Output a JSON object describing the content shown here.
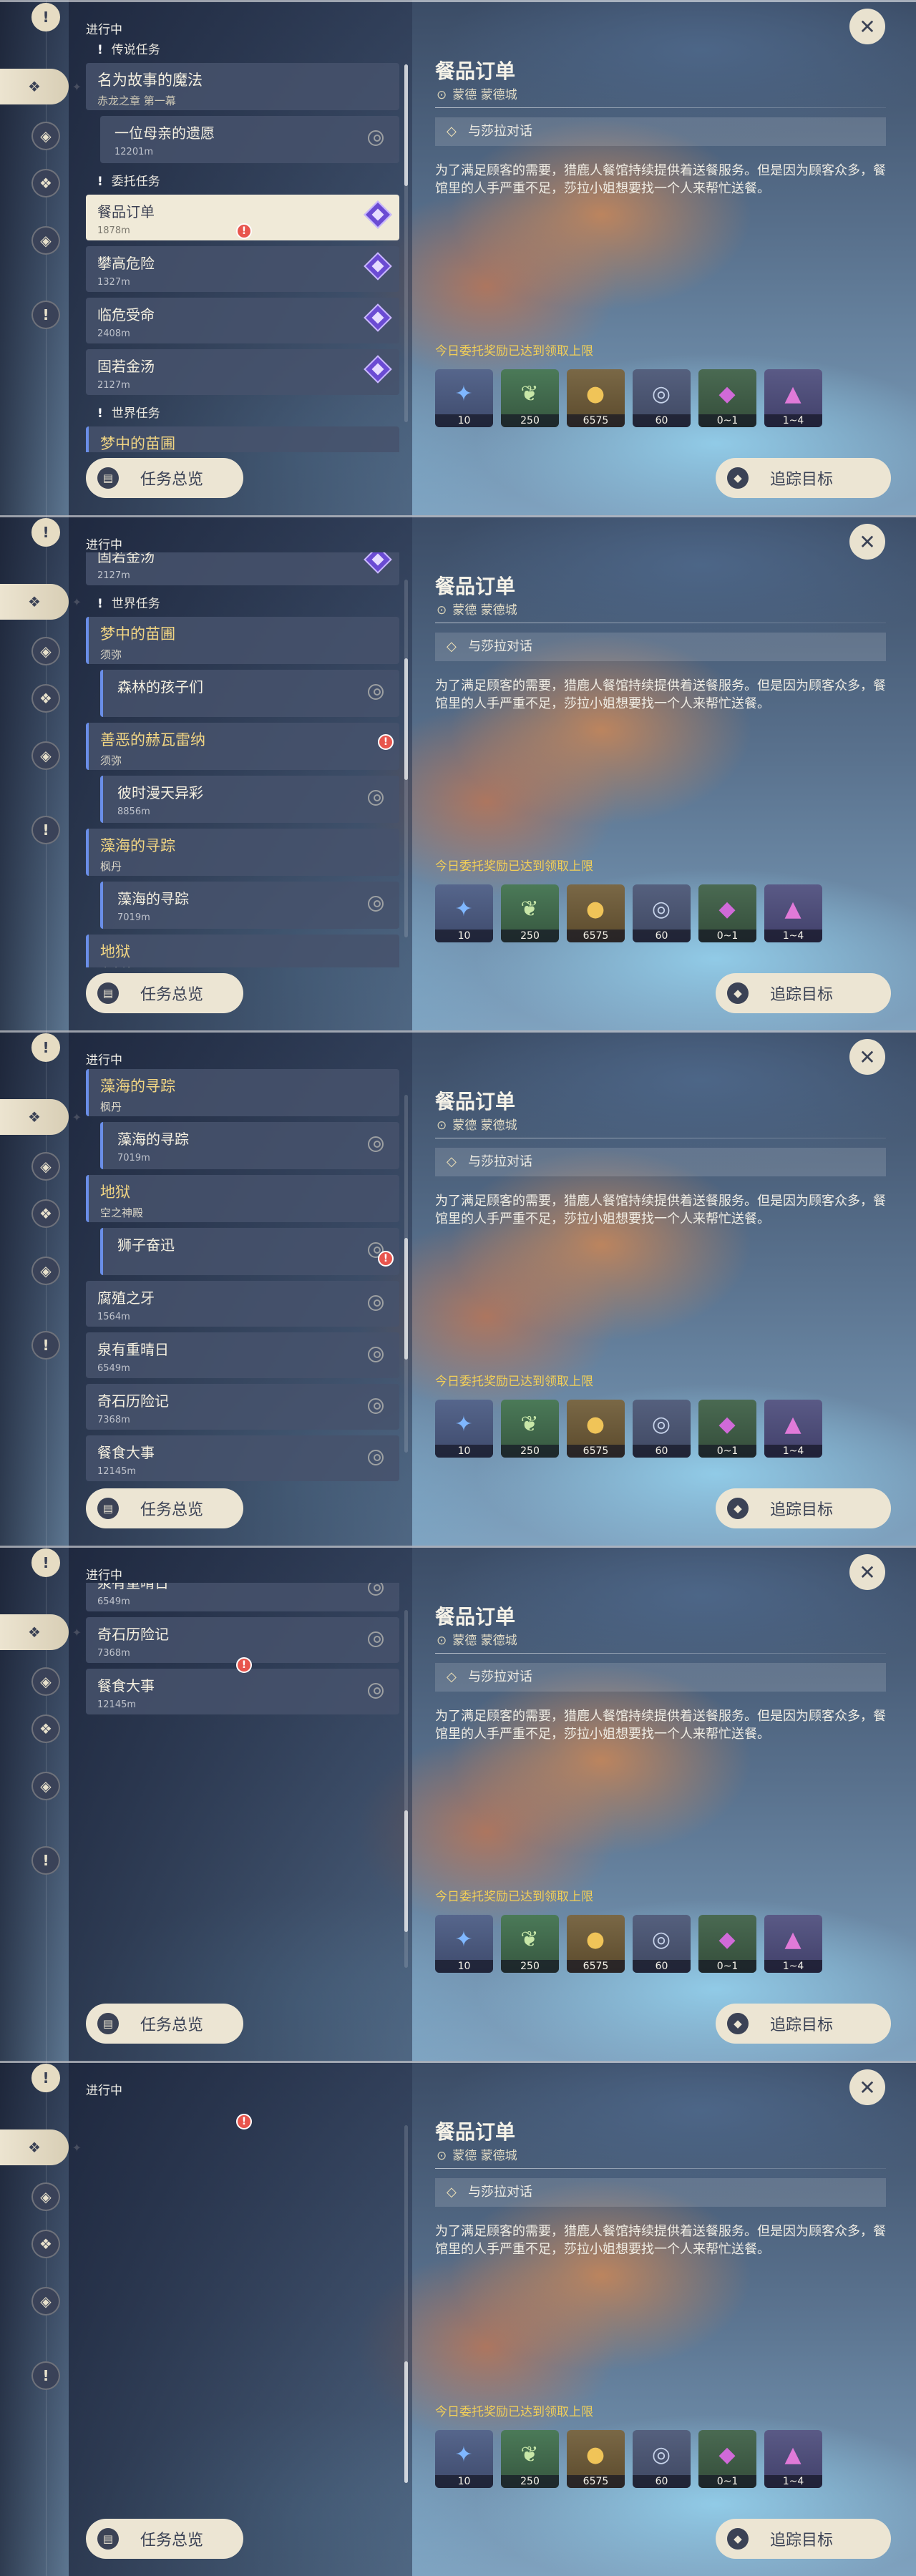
{
  "app": {
    "ongoing_label": "进行中",
    "overview_label": "任务总览",
    "track_label": "追踪目标",
    "close_glyph": "✕",
    "rail_icon_names": [
      "quest-tab-icon",
      "archon-quest-icon",
      "story-quest-icon",
      "commission-quest-icon",
      "world-quest-icon",
      "event-quest-icon"
    ]
  },
  "sections": {
    "legend": "传说任务",
    "commission": "委托任务",
    "world": "世界任务"
  },
  "quests": {
    "legend_main": {
      "name": "名为故事的魔法",
      "sub": "赤龙之章 第一幕"
    },
    "legend_sub": {
      "name": "一位母亲的遗愿",
      "dist": "12201m"
    },
    "commission": [
      {
        "name": "餐品订单",
        "dist": "1878m"
      },
      {
        "name": "攀高危险",
        "dist": "1327m"
      },
      {
        "name": "临危受命",
        "dist": "2408m"
      },
      {
        "name": "固若金汤",
        "dist": "2127m"
      }
    ],
    "world": [
      {
        "name": "梦中的苗圃",
        "region": "须弥",
        "sub": {
          "name": "森林的孩子们",
          "dist": ""
        }
      },
      {
        "name": "善恶的赫瓦雷纳",
        "region": "须弥",
        "sub": {
          "name": "彼时漫天异彩",
          "dist": "8856m"
        }
      },
      {
        "name": "藻海的寻踪",
        "region": "枫丹",
        "sub": {
          "name": "藻海的寻踪",
          "dist": "7019m"
        }
      },
      {
        "name": "地狱",
        "region": "空之神殿",
        "sub": {
          "name": "狮子奋迅",
          "dist": ""
        }
      }
    ],
    "other": [
      {
        "name": "腐殖之牙",
        "dist": "1564m"
      },
      {
        "name": "泉有重晴日",
        "dist": "6549m"
      },
      {
        "name": "奇石历险记",
        "dist": "7368m"
      },
      {
        "name": "餐食大事",
        "dist": "12145m"
      }
    ]
  },
  "detail": {
    "title": "餐品订单",
    "location": "蒙德 蒙德城",
    "objective": "与莎拉对话",
    "description": "为了满足顾客的需要，猎鹿人餐馆持续提供着送餐服务。但是因为顾客众多，餐馆里的人手严重不足，莎拉小姐想要找一个人来帮忙送餐。",
    "reward_limit": "今日委托奖励已达到领取上限",
    "rewards": [
      {
        "icon": "adventure-exp-icon",
        "amount": "10"
      },
      {
        "icon": "character-exp-icon",
        "amount": "250"
      },
      {
        "icon": "mora-icon",
        "amount": "6575"
      },
      {
        "icon": "companionship-exp-icon",
        "amount": "60"
      },
      {
        "icon": "ore-icon",
        "amount": "0~1"
      },
      {
        "icon": "crystal-icon",
        "amount": "1~4"
      }
    ]
  },
  "colors": {
    "accent": "#f2cf58",
    "selection": "#f0ead8",
    "quest_purple": "#6b4bd3",
    "alert_red": "#e8554d",
    "world_bar": "#6a8ee8"
  },
  "shots": [
    {
      "active_rail": 1,
      "alert_item": "commission-3"
    },
    {
      "active_rail": 1,
      "alert_item": "world-1-sub"
    },
    {
      "active_rail": 1,
      "alert_item": "world-1-sub"
    },
    {
      "active_rail": 1,
      "alert_item": "world-2-sub"
    },
    {
      "active_rail": 1,
      "alert_item": "world-3-sub"
    }
  ]
}
